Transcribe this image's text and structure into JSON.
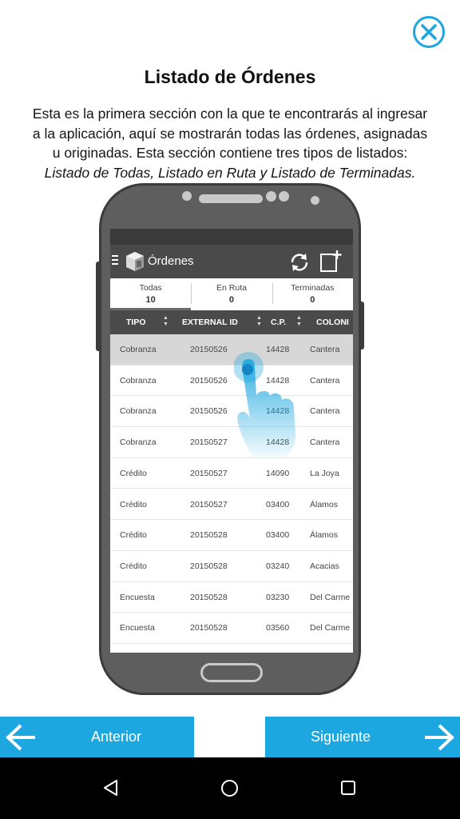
{
  "title": "Listado de Órdenes",
  "description": {
    "line1": "Esta es la primera sección con la que te encontrarás al ingresar",
    "line2": "a la aplicación, aquí se mostrarán todas las órdenes, asignadas",
    "line3": "u originadas. Esta sección contiene tres tipos de listados:",
    "line4": "Listado de Todas, Listado en Ruta y Listado de Terminadas."
  },
  "phone_app": {
    "title": "Órdenes",
    "tabs": [
      {
        "label": "Todas",
        "count": "10"
      },
      {
        "label": "En Ruta",
        "count": "0"
      },
      {
        "label": "Terminadas",
        "count": "0"
      }
    ],
    "columns": [
      "TIPO",
      "EXTERNAL ID",
      "C.P.",
      "COLONI"
    ],
    "rows": [
      {
        "tipo": "Cobranza",
        "id": "20150526",
        "cp": "14428",
        "colonia": "Cantera"
      },
      {
        "tipo": "Cobranza",
        "id": "20150526",
        "cp": "14428",
        "colonia": "Cantera"
      },
      {
        "tipo": "Cobranza",
        "id": "20150526",
        "cp": "14428",
        "colonia": "Cantera"
      },
      {
        "tipo": "Cobranza",
        "id": "20150527",
        "cp": "14428",
        "colonia": "Cantera"
      },
      {
        "tipo": "Crédito",
        "id": "20150527",
        "cp": "14090",
        "colonia": "La Joya"
      },
      {
        "tipo": "Crédito",
        "id": "20150527",
        "cp": "03400",
        "colonia": "Álamos"
      },
      {
        "tipo": "Crédito",
        "id": "20150528",
        "cp": "03400",
        "colonia": "Álamos"
      },
      {
        "tipo": "Crédito",
        "id": "20150528",
        "cp": "03240",
        "colonia": "Acacias"
      },
      {
        "tipo": "Encuesta",
        "id": "20150528",
        "cp": "03230",
        "colonia": "Del Carme"
      },
      {
        "tipo": "Encuesta",
        "id": "20150528",
        "cp": "03560",
        "colonia": "Del Carme"
      }
    ],
    "selected_row": 0
  },
  "nav": {
    "previous_label": "Anterior",
    "next_label": "Siguiente"
  },
  "colors": {
    "accent": "#1ca7e0",
    "phone_body": "#5e5e5e",
    "app_bar": "#4a4a4a"
  },
  "icons": [
    "close-icon",
    "menu-icon",
    "app-logo-icon",
    "refresh-icon",
    "new-order-icon",
    "tap-hand-icon",
    "arrow-left-icon",
    "arrow-right-icon",
    "system-back-icon",
    "system-home-icon",
    "system-recents-icon"
  ]
}
